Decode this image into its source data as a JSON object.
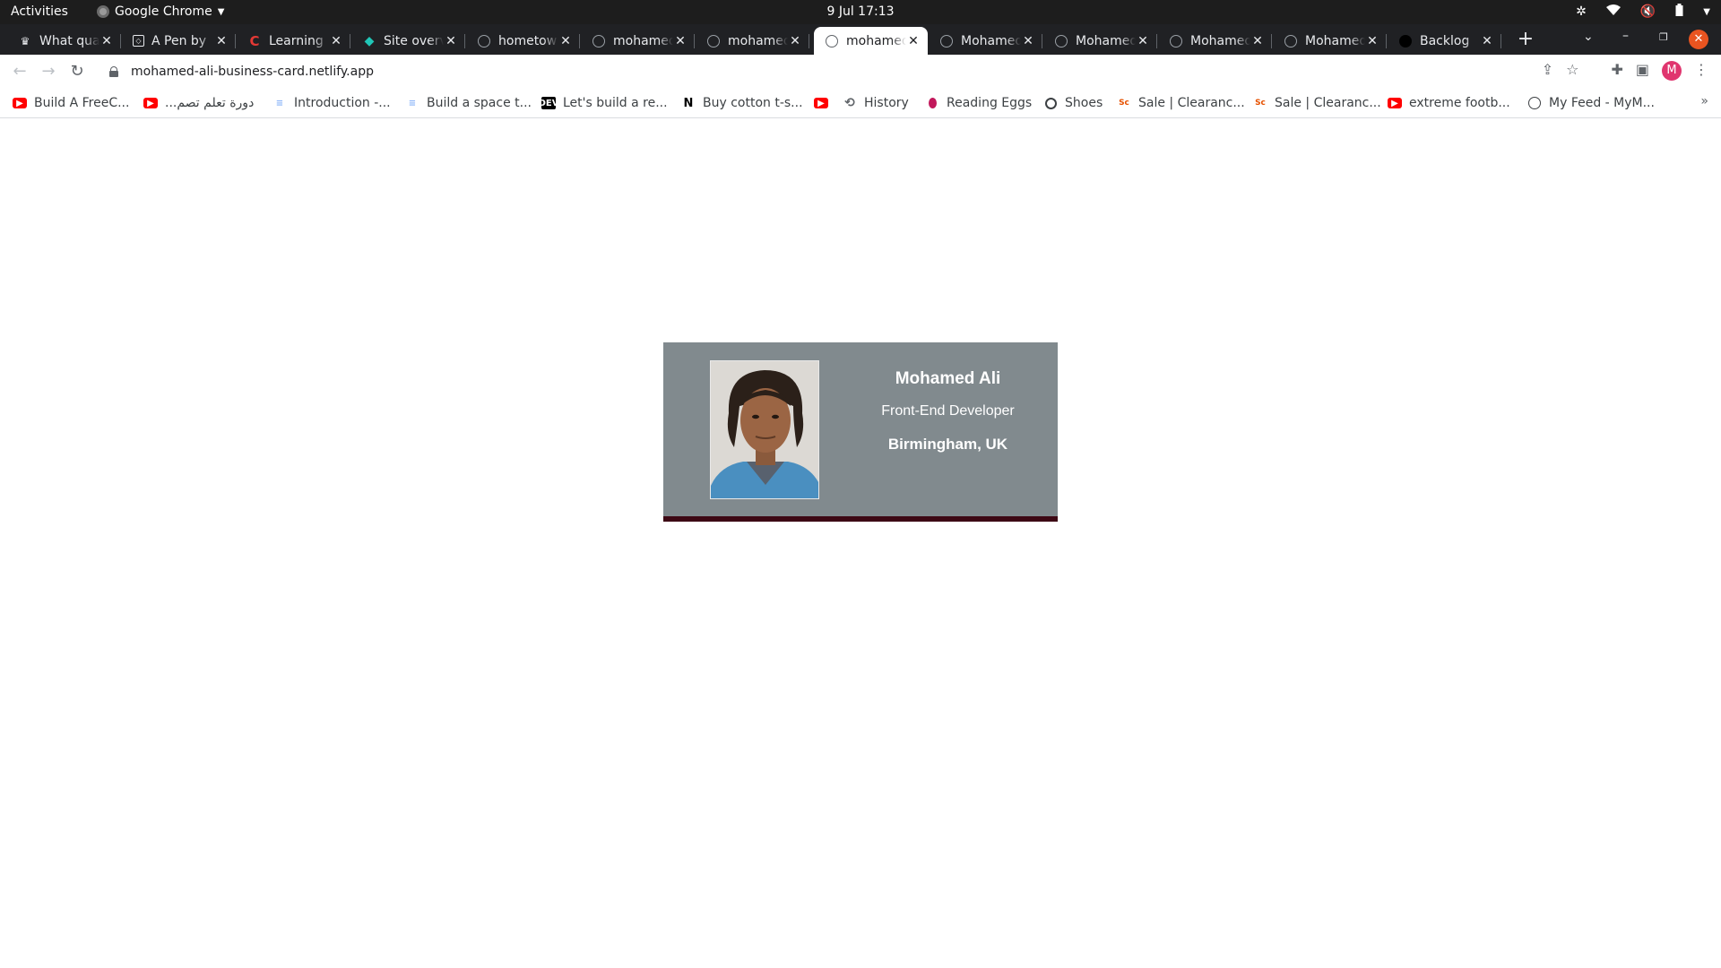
{
  "system": {
    "activities": "Activities",
    "app_name": "Google Chrome",
    "clock": "9 Jul  17:13"
  },
  "tabs": [
    {
      "title": "What qua",
      "favicon": "crown-icon",
      "active": false
    },
    {
      "title": "A Pen by",
      "favicon": "codepen-icon",
      "active": false
    },
    {
      "title": "Learning",
      "favicon": "c-logo-icon",
      "active": false
    },
    {
      "title": "Site overv",
      "favicon": "netlify-icon",
      "active": false
    },
    {
      "title": "hometow",
      "favicon": "globe-icon",
      "active": false
    },
    {
      "title": "mohamed",
      "favicon": "globe-icon",
      "active": false
    },
    {
      "title": "mohamed",
      "favicon": "globe-icon",
      "active": false
    },
    {
      "title": "mohamed",
      "favicon": "globe-icon",
      "active": true
    },
    {
      "title": "Mohamed",
      "favicon": "globe-icon",
      "active": false
    },
    {
      "title": "Mohamed",
      "favicon": "globe-icon",
      "active": false
    },
    {
      "title": "Mohamed",
      "favicon": "globe-icon",
      "active": false
    },
    {
      "title": "Mohamed",
      "favicon": "globe-icon",
      "active": false
    },
    {
      "title": "Backlog",
      "favicon": "github-icon",
      "active": false
    }
  ],
  "address": {
    "url": "mohamed-ali-business-card.netlify.app"
  },
  "profile": {
    "initial": "M"
  },
  "bookmarks": [
    {
      "label": "Build A FreeC...",
      "icon": "youtube-icon"
    },
    {
      "label": "دورة تعلم تصم...",
      "icon": "youtube-icon"
    },
    {
      "label": "Introduction -...",
      "icon": "lines-icon"
    },
    {
      "label": "Build a space t...",
      "icon": "lines-icon"
    },
    {
      "label": "Let's build a re...",
      "icon": "dev-icon"
    },
    {
      "label": "Buy cotton t-s...",
      "icon": "n-logo-icon"
    },
    {
      "label": "",
      "icon": "youtube-icon"
    },
    {
      "label": "History",
      "icon": "history-icon"
    },
    {
      "label": "Reading Eggs",
      "icon": "egg-icon"
    },
    {
      "label": "Shoes",
      "icon": "globe-icon"
    },
    {
      "label": "Sale | Clearanc...",
      "icon": "store-icon"
    },
    {
      "label": "Sale | Clearanc...",
      "icon": "store-icon"
    },
    {
      "label": "extreme footb...",
      "icon": "youtube-icon"
    },
    {
      "label": "My Feed - MyM...",
      "icon": "web-icon"
    }
  ],
  "card": {
    "name": "Mohamed Ali",
    "role": "Front-End Developer",
    "location": "Birmingham, UK",
    "background": "#818a8e",
    "accent": "#3d0814"
  }
}
